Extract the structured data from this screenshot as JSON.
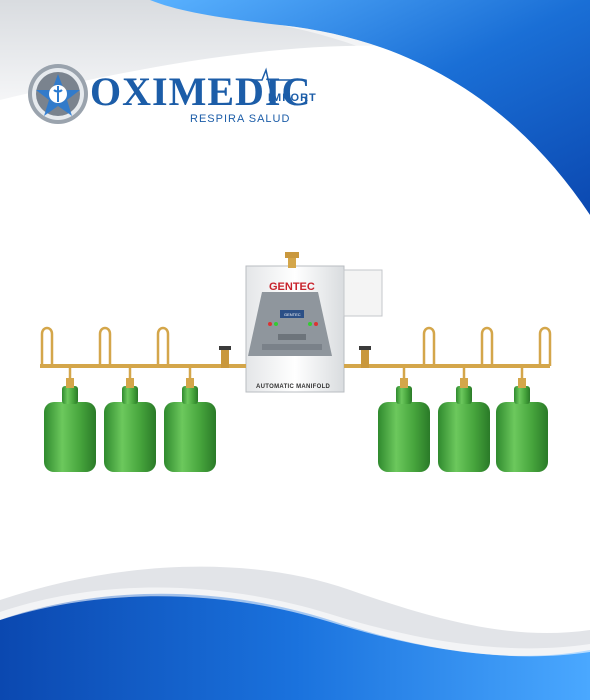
{
  "logo": {
    "name": "OXIMEDIC",
    "suffix": "IMPORT",
    "tagline": "RESPIRA SALUD"
  },
  "manifold": {
    "brand": "GENTEC",
    "label": "AUTOMATIC MANIFOLD",
    "screen": "GENTEC"
  },
  "colors": {
    "brand_blue": "#1c5da8",
    "wave_blue": "#1a6fd6",
    "cylinder_green": "#4aaa3f",
    "brass": "#d4a64a"
  }
}
